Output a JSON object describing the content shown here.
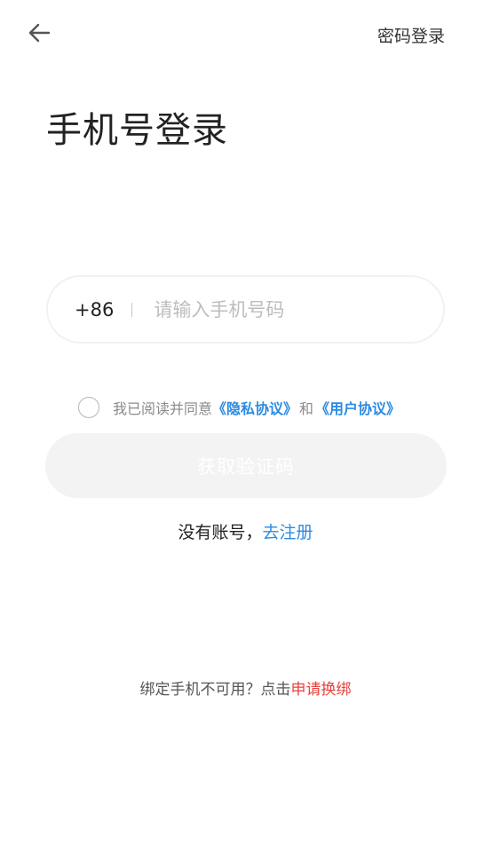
{
  "header": {
    "back_icon": "arrow-left-icon",
    "password_login_label": "密码登录"
  },
  "title": "手机号登录",
  "phone": {
    "country_code": "+86",
    "placeholder": "请输入手机号码",
    "value": ""
  },
  "agreement": {
    "checked": false,
    "prefix": "我已阅读并同意",
    "privacy_link": "《隐私协议》",
    "and": "和",
    "user_link": "《用户协议》"
  },
  "submit": {
    "label": "获取验证码",
    "enabled": false
  },
  "register": {
    "prompt": "没有账号，",
    "link": "去注册"
  },
  "rebind": {
    "prompt": "绑定手机不可用？点击",
    "link": "申请换绑"
  },
  "colors": {
    "link_blue": "#2c8be0",
    "link_red": "#e8413c",
    "disabled_button_bg": "#f3f3f3"
  }
}
